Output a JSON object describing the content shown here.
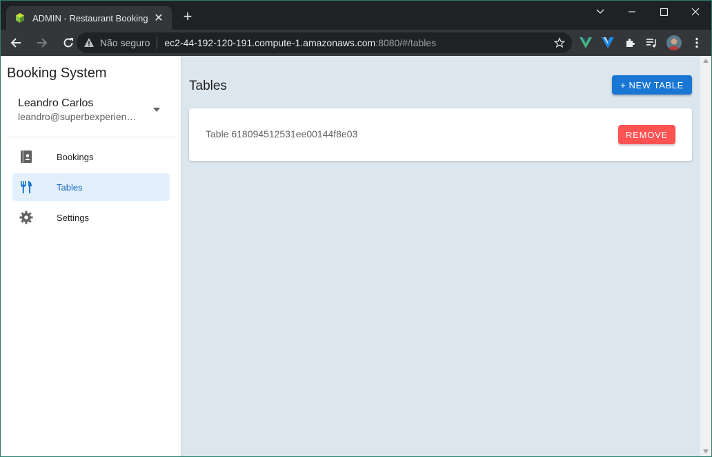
{
  "browser": {
    "tab_title": "ADMIN - Restaurant Booking",
    "new_tab": "+",
    "security_label": "Não seguro",
    "url_host": "ec2-44-192-120-191.compute-1.amazonaws.com",
    "url_rest": ":8080/#/tables"
  },
  "sidebar": {
    "brand": "Booking System",
    "user_name": "Leandro Carlos",
    "user_email": "leandro@superbexperience.com",
    "items": [
      {
        "label": "Bookings",
        "icon": "book-icon",
        "active": false
      },
      {
        "label": "Tables",
        "icon": "silverware-icon",
        "active": true
      },
      {
        "label": "Settings",
        "icon": "gear-icon",
        "active": false
      }
    ]
  },
  "main": {
    "title": "Tables",
    "new_button": "+ NEW TABLE",
    "tables": [
      {
        "label": "Table 618094512531ee00144f8e03",
        "remove_label": "REMOVE"
      }
    ]
  },
  "colors": {
    "primary": "#1976d2",
    "danger": "#ff5252",
    "active_bg": "#e3f0fc",
    "content_bg": "#dce6ee"
  }
}
